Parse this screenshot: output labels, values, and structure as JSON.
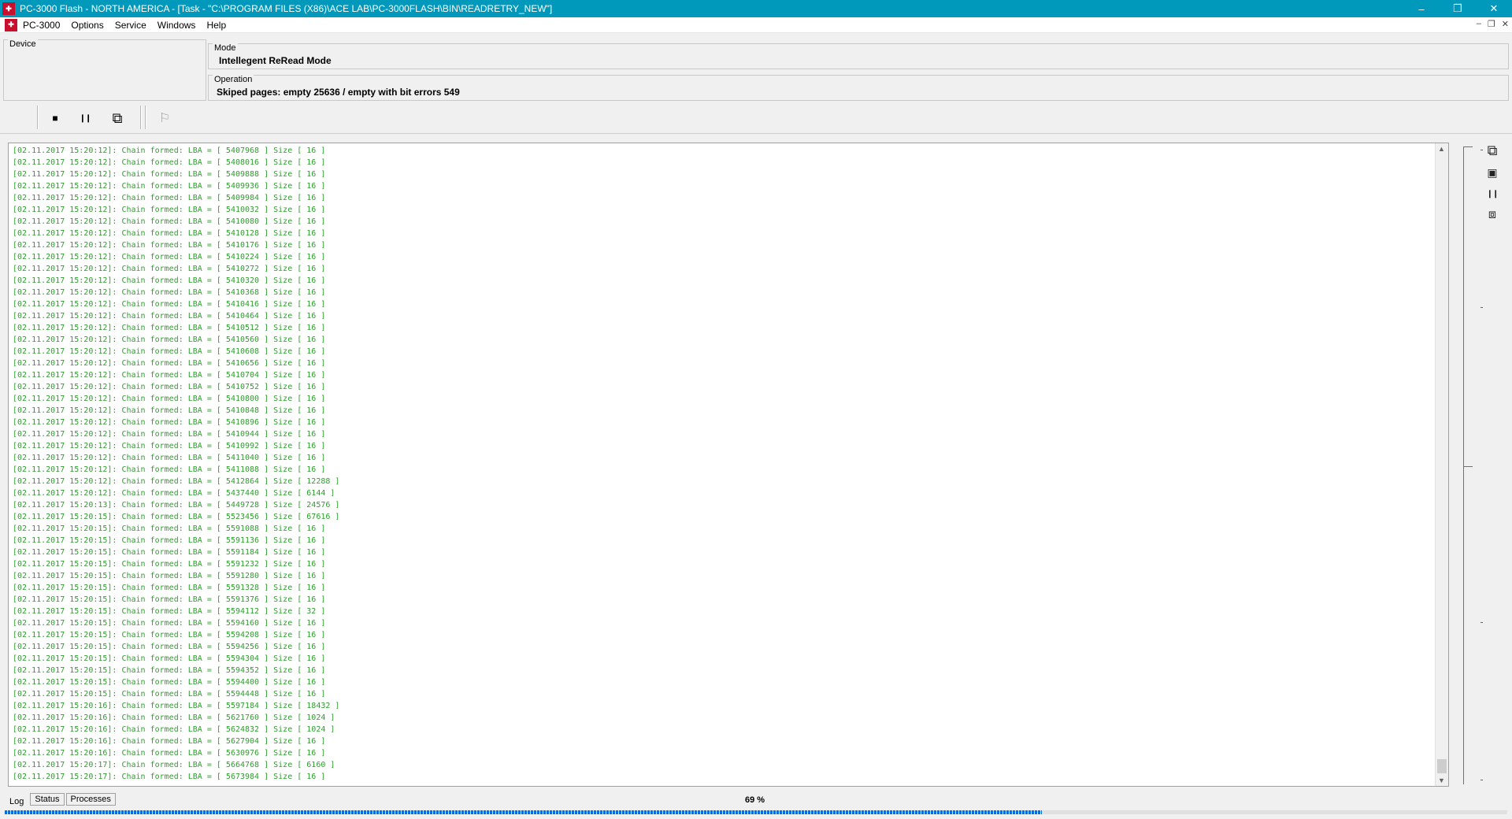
{
  "window": {
    "title": "PC-3000 Flash - NORTH AMERICA - [Task - \"C:\\PROGRAM FILES (X86)\\ACE LAB\\PC-3000FLASH\\BIN\\READRETRY_NEW\"]",
    "controls": {
      "minimize": "–",
      "restore": "❐",
      "close": "✕"
    }
  },
  "menu": {
    "items": [
      {
        "label": "PC-3000"
      },
      {
        "label": "Options"
      },
      {
        "label": "Service"
      },
      {
        "label": "Windows"
      },
      {
        "label": "Help"
      }
    ],
    "mdi_controls": {
      "minimize": "–",
      "restore": "❐",
      "close": "✕"
    }
  },
  "device": {
    "legend": "Device"
  },
  "mode": {
    "legend": "Mode",
    "value": "Intellegent ReRead Mode"
  },
  "operation": {
    "legend": "Operation",
    "value": "Skiped pages: empty 25636 / empty with bit errors 549"
  },
  "toolbar": {
    "stop_icon": "■",
    "pause_icon": "❙❙",
    "export_icon": "⧉",
    "disabled_icon": "⚐"
  },
  "log": {
    "lines": [
      "[02.11.2017 15:20:12]: Chain formed: LBA = [ 5407968 ] Size [ 16 ]",
      "[02.11.2017 15:20:12]: Chain formed: LBA = [ 5408016 ] Size [ 16 ]",
      "[02.11.2017 15:20:12]: Chain formed: LBA = [ 5409888 ] Size [ 16 ]",
      "[02.11.2017 15:20:12]: Chain formed: LBA = [ 5409936 ] Size [ 16 ]",
      "[02.11.2017 15:20:12]: Chain formed: LBA = [ 5409984 ] Size [ 16 ]",
      "[02.11.2017 15:20:12]: Chain formed: LBA = [ 5410032 ] Size [ 16 ]",
      "[02.11.2017 15:20:12]: Chain formed: LBA = [ 5410080 ] Size [ 16 ]",
      "[02.11.2017 15:20:12]: Chain formed: LBA = [ 5410128 ] Size [ 16 ]",
      "[02.11.2017 15:20:12]: Chain formed: LBA = [ 5410176 ] Size [ 16 ]",
      "[02.11.2017 15:20:12]: Chain formed: LBA = [ 5410224 ] Size [ 16 ]",
      "[02.11.2017 15:20:12]: Chain formed: LBA = [ 5410272 ] Size [ 16 ]",
      "[02.11.2017 15:20:12]: Chain formed: LBA = [ 5410320 ] Size [ 16 ]",
      "[02.11.2017 15:20:12]: Chain formed: LBA = [ 5410368 ] Size [ 16 ]",
      "[02.11.2017 15:20:12]: Chain formed: LBA = [ 5410416 ] Size [ 16 ]",
      "[02.11.2017 15:20:12]: Chain formed: LBA = [ 5410464 ] Size [ 16 ]",
      "[02.11.2017 15:20:12]: Chain formed: LBA = [ 5410512 ] Size [ 16 ]",
      "[02.11.2017 15:20:12]: Chain formed: LBA = [ 5410560 ] Size [ 16 ]",
      "[02.11.2017 15:20:12]: Chain formed: LBA = [ 5410608 ] Size [ 16 ]",
      "[02.11.2017 15:20:12]: Chain formed: LBA = [ 5410656 ] Size [ 16 ]",
      "[02.11.2017 15:20:12]: Chain formed: LBA = [ 5410704 ] Size [ 16 ]",
      "[02.11.2017 15:20:12]: Chain formed: LBA = [ 5410752 ] Size [ 16 ]",
      "[02.11.2017 15:20:12]: Chain formed: LBA = [ 5410800 ] Size [ 16 ]",
      "[02.11.2017 15:20:12]: Chain formed: LBA = [ 5410848 ] Size [ 16 ]",
      "[02.11.2017 15:20:12]: Chain formed: LBA = [ 5410896 ] Size [ 16 ]",
      "[02.11.2017 15:20:12]: Chain formed: LBA = [ 5410944 ] Size [ 16 ]",
      "[02.11.2017 15:20:12]: Chain formed: LBA = [ 5410992 ] Size [ 16 ]",
      "[02.11.2017 15:20:12]: Chain formed: LBA = [ 5411040 ] Size [ 16 ]",
      "[02.11.2017 15:20:12]: Chain formed: LBA = [ 5411088 ] Size [ 16 ]",
      "[02.11.2017 15:20:12]: Chain formed: LBA = [ 5412864 ] Size [ 12288 ]",
      "[02.11.2017 15:20:12]: Chain formed: LBA = [ 5437440 ] Size [ 6144 ]",
      "[02.11.2017 15:20:13]: Chain formed: LBA = [ 5449728 ] Size [ 24576 ]",
      "[02.11.2017 15:20:15]: Chain formed: LBA = [ 5523456 ] Size [ 67616 ]",
      "[02.11.2017 15:20:15]: Chain formed: LBA = [ 5591088 ] Size [ 16 ]",
      "[02.11.2017 15:20:15]: Chain formed: LBA = [ 5591136 ] Size [ 16 ]",
      "[02.11.2017 15:20:15]: Chain formed: LBA = [ 5591184 ] Size [ 16 ]",
      "[02.11.2017 15:20:15]: Chain formed: LBA = [ 5591232 ] Size [ 16 ]",
      "[02.11.2017 15:20:15]: Chain formed: LBA = [ 5591280 ] Size [ 16 ]",
      "[02.11.2017 15:20:15]: Chain formed: LBA = [ 5591328 ] Size [ 16 ]",
      "[02.11.2017 15:20:15]: Chain formed: LBA = [ 5591376 ] Size [ 16 ]",
      "[02.11.2017 15:20:15]: Chain formed: LBA = [ 5594112 ] Size [ 32 ]",
      "[02.11.2017 15:20:15]: Chain formed: LBA = [ 5594160 ] Size [ 16 ]",
      "[02.11.2017 15:20:15]: Chain formed: LBA = [ 5594208 ] Size [ 16 ]",
      "[02.11.2017 15:20:15]: Chain formed: LBA = [ 5594256 ] Size [ 16 ]",
      "[02.11.2017 15:20:15]: Chain formed: LBA = [ 5594304 ] Size [ 16 ]",
      "[02.11.2017 15:20:15]: Chain formed: LBA = [ 5594352 ] Size [ 16 ]",
      "[02.11.2017 15:20:15]: Chain formed: LBA = [ 5594400 ] Size [ 16 ]",
      "[02.11.2017 15:20:15]: Chain formed: LBA = [ 5594448 ] Size [ 16 ]",
      "[02.11.2017 15:20:16]: Chain formed: LBA = [ 5597184 ] Size [ 18432 ]",
      "[02.11.2017 15:20:16]: Chain formed: LBA = [ 5621760 ] Size [ 1024 ]",
      "[02.11.2017 15:20:16]: Chain formed: LBA = [ 5624832 ] Size [ 1024 ]",
      "[02.11.2017 15:20:16]: Chain formed: LBA = [ 5627904 ] Size [ 16 ]",
      "[02.11.2017 15:20:16]: Chain formed: LBA = [ 5630976 ] Size [ 16 ]",
      "[02.11.2017 15:20:17]: Chain formed: LBA = [ 5664768 ] Size [ 6160 ]",
      "[02.11.2017 15:20:17]: Chain formed: LBA = [ 5673984 ] Size [ 16 ]"
    ]
  },
  "side_buttons": {
    "export_icon": "⧉",
    "save_icon": "▣",
    "pause_icon": "❙❙",
    "copy_icon": "⧈"
  },
  "bottom_tabs": [
    {
      "label": "Log"
    },
    {
      "label": "Status"
    },
    {
      "label": "Processes"
    }
  ],
  "progress": {
    "label": "69 %",
    "value": 0.69
  }
}
